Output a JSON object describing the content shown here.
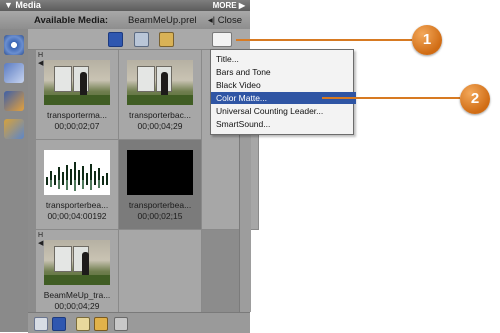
{
  "panel": {
    "header_title": "Media",
    "more_label": "MORE",
    "available_label": "Available Media:",
    "project_file": "BeamMeUp.prel",
    "close_label": "Close"
  },
  "grid": [
    {
      "name": "transporterma...",
      "duration": "00;00;02;07"
    },
    {
      "name": "transporterbac...",
      "duration": "00;00;04;29"
    },
    {
      "name": "transporterbea...",
      "duration": "00;00;04:00192"
    },
    {
      "name": "transporterbea...",
      "duration": "00;00;02;15"
    },
    {
      "name": "BeamMeUp_tra...",
      "duration": "00;00;04;29"
    }
  ],
  "menu": {
    "items": [
      "Title...",
      "Bars and Tone",
      "Black Video",
      "Color Matte...",
      "Universal Counting Leader...",
      "SmartSound..."
    ],
    "highlighted_index": 3
  },
  "callouts": {
    "first": "1",
    "second": "2"
  },
  "colors": {
    "accent": "#d06c14",
    "menu_highlight": "#2f55a4"
  }
}
